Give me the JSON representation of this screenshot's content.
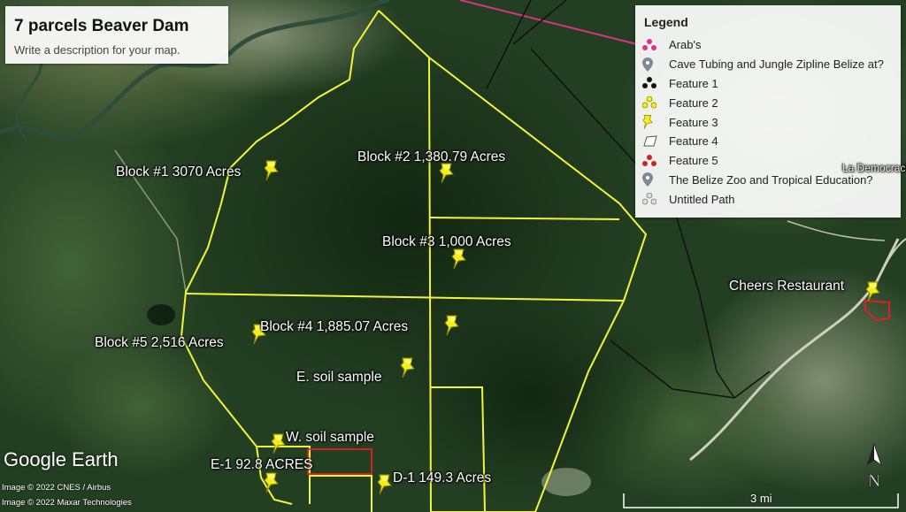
{
  "map_title": "7 parcels Beaver Dam",
  "map_description": "Write a description for your map.",
  "legend": {
    "heading": "Legend",
    "items": [
      {
        "label": "Arab's",
        "icon": "pink-cluster-icon"
      },
      {
        "label": "Cave Tubing and Jungle Zipline Belize at?",
        "icon": "gray-pin-icon"
      },
      {
        "label": "Feature 1",
        "icon": "black-cluster-icon"
      },
      {
        "label": "Feature 2",
        "icon": "yellow-cluster-icon"
      },
      {
        "label": "Feature 3",
        "icon": "yellow-pushpin-icon"
      },
      {
        "label": "Feature 4",
        "icon": "polygon-icon"
      },
      {
        "label": "Feature 5",
        "icon": "red-cluster-icon"
      },
      {
        "label": "The Belize Zoo and Tropical Education?",
        "icon": "gray-pin-icon"
      },
      {
        "label": "Untitled Path",
        "icon": "gray-cluster-icon"
      }
    ]
  },
  "placemarks": {
    "block1": "Block #1 3070 Acres",
    "block2": "Block #2  1,380.79 Acres",
    "block3": "Block #3 1,000 Acres",
    "block4": "Block #4    1,885.07 Acres",
    "block5": "Block #5  2,516 Acres",
    "e_soil": "E. soil sample",
    "w_soil": "W. soil sample",
    "e1": "E-1 92.8 ACRES",
    "d1": "D-1 149.3 Acres",
    "cheers": "Cheers Restaurant",
    "place": "La Democracia"
  },
  "branding": "Google Earth",
  "credits": [
    "Image © 2022 CNES / Airbus",
    "Image © 2022 Maxar Technologies"
  ],
  "scale": "3 mi",
  "north_label": "N",
  "colors": {
    "boundary": "#f3f33a",
    "pushpin": "#f2ee1c",
    "parcel_red": "#e02020",
    "road_pink": "#d8328c"
  }
}
